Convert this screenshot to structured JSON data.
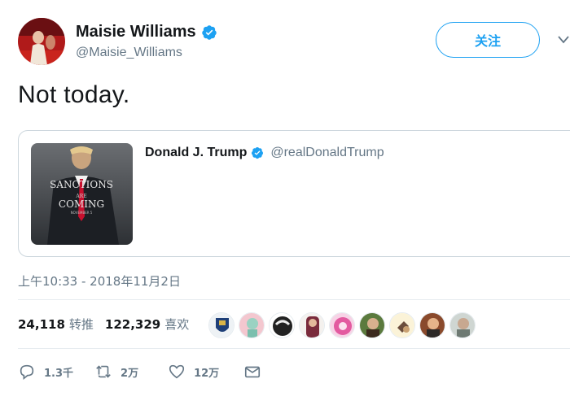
{
  "author": {
    "name": "Maisie Williams",
    "handle": "@Maisie_Williams",
    "avatar": "avatar-red-carpet",
    "verified": true
  },
  "follow_button": {
    "label": "关注"
  },
  "tweet": {
    "text": "Not today."
  },
  "quoted_tweet": {
    "name": "Donald J. Trump",
    "handle": "@realDonaldTrump",
    "verified": true,
    "image": {
      "lines": [
        "SANCTIONS",
        "ARE",
        "COMING",
        "NOVEMBER 5"
      ]
    }
  },
  "timestamp": "上午10:33 - 2018年11月2日",
  "stats": {
    "retweets_count": "24,118",
    "retweets_label": "转推",
    "likes_count": "122,329",
    "likes_label": "喜欢"
  },
  "likers": [
    "liker-avatar-1",
    "liker-avatar-2",
    "liker-avatar-3",
    "liker-avatar-4",
    "liker-avatar-5",
    "liker-avatar-6",
    "liker-avatar-7",
    "liker-avatar-8",
    "liker-avatar-9",
    "liker-avatar-10"
  ],
  "actions": {
    "reply_count": "1.3千",
    "retweet_count": "2万",
    "like_count": "12万"
  },
  "colors": {
    "accent": "#1da1f2",
    "secondary_text": "#657786",
    "border": "#ccd6dd"
  }
}
